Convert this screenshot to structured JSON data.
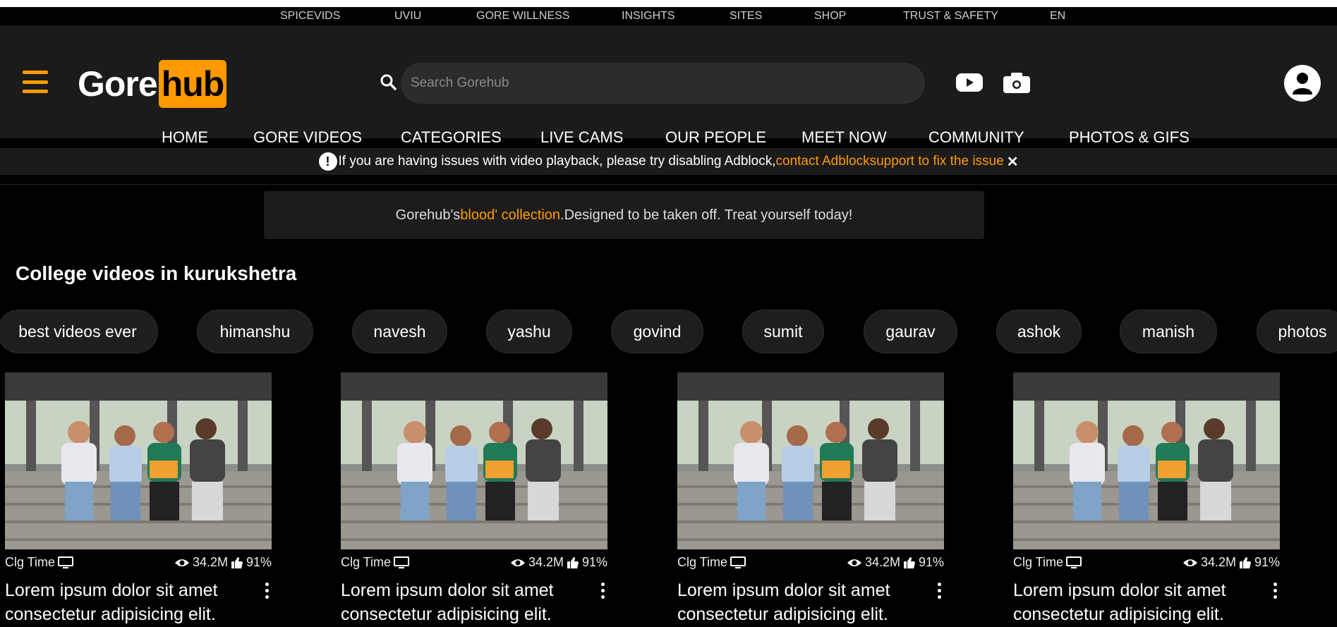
{
  "top_links": [
    "SPICEVIDS",
    "UVIU",
    "GORE WILLNESS",
    "INSIGHTS",
    "SITES",
    "SHOP",
    "TRUST & SAFETY",
    "EN"
  ],
  "logo": {
    "part1": "Gore",
    "part2": "hub"
  },
  "search": {
    "placeholder": "Search Gorehub"
  },
  "main_nav": [
    "HOME",
    "GORE VIDEOS",
    "CATEGORIES",
    "LIVE CAMS",
    "OUR PEOPLE",
    "MEET NOW",
    "COMMUNITY",
    "PHOTOS & GIFS"
  ],
  "alert": {
    "text": "If you are having issues with video playback, please try disabling Adblock,",
    "link": "contact Adblocksupport to fix the issue",
    "close": "✕"
  },
  "promo": {
    "pre": "Gorehub's ",
    "highlight": "blood' collection",
    "post": " .Designed to be taken off. Treat yourself today!"
  },
  "section_title": "College videos in kurukshetra",
  "chips": [
    "best videos ever",
    "himanshu",
    "navesh",
    "yashu",
    "govind",
    "sumit",
    "gaurav",
    "ashok",
    "manish",
    "photos"
  ],
  "cards": [
    {
      "channel": "Clg Time",
      "views": "34.2M",
      "rating": "91%",
      "title": "Lorem ipsum dolor sit amet consectetur adipisicing elit."
    },
    {
      "channel": "Clg Time",
      "views": "34.2M",
      "rating": "91%",
      "title": "Lorem ipsum dolor sit amet consectetur adipisicing elit."
    },
    {
      "channel": "Clg Time",
      "views": "34.2M",
      "rating": "91%",
      "title": "Lorem ipsum dolor sit amet consectetur adipisicing elit."
    },
    {
      "channel": "Clg Time",
      "views": "34.2M",
      "rating": "91%",
      "title": "Lorem ipsum dolor sit amet consectetur adipisicing elit."
    }
  ],
  "colors": {
    "accent": "#ff9900",
    "header_bg": "#1b1b1b",
    "page_bg": "#000000"
  }
}
